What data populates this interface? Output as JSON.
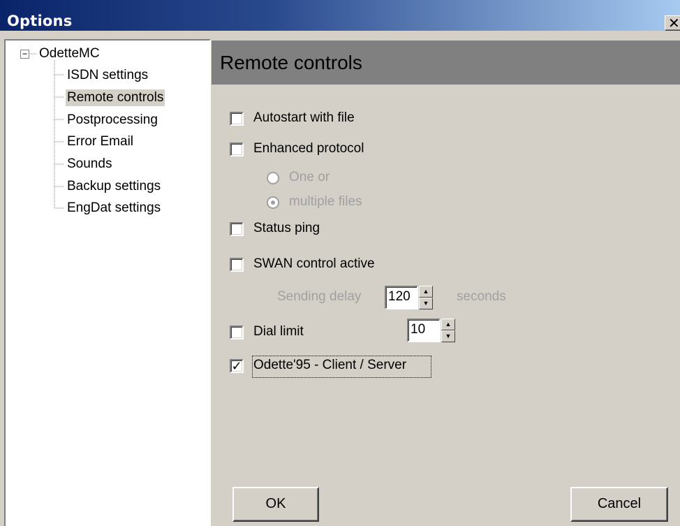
{
  "window": {
    "title": "Options",
    "close_label": "✕"
  },
  "tree": {
    "root": {
      "label": "OdetteMC",
      "expander": "−"
    },
    "items": [
      {
        "label": "ISDN settings"
      },
      {
        "label": "Remote controls",
        "selected": true
      },
      {
        "label": "Postprocessing"
      },
      {
        "label": "Error Email"
      },
      {
        "label": "Sounds"
      },
      {
        "label": "Backup settings"
      },
      {
        "label": "EngDat settings"
      }
    ]
  },
  "panel": {
    "title": "Remote controls",
    "autostart": {
      "label": "Autostart with file",
      "checked": false
    },
    "enhanced": {
      "label": "Enhanced protocol",
      "checked": false
    },
    "radio_one": {
      "label": "One or",
      "selected": false
    },
    "radio_multiple": {
      "label": "multiple files",
      "selected": true
    },
    "status_ping": {
      "label": "Status ping",
      "checked": false
    },
    "swan": {
      "label": "SWAN control active",
      "checked": false
    },
    "sending_delay": {
      "label": "Sending delay",
      "value": "120",
      "unit": "seconds"
    },
    "dial_limit": {
      "label": "Dial limit",
      "checked": false,
      "value": "10"
    },
    "odette95": {
      "label": "Odette'95  - Client / Server",
      "checked": true,
      "check_mark": "✓"
    },
    "spin_up": "▲",
    "spin_down": "▼"
  },
  "buttons": {
    "ok": "OK",
    "cancel": "Cancel"
  }
}
